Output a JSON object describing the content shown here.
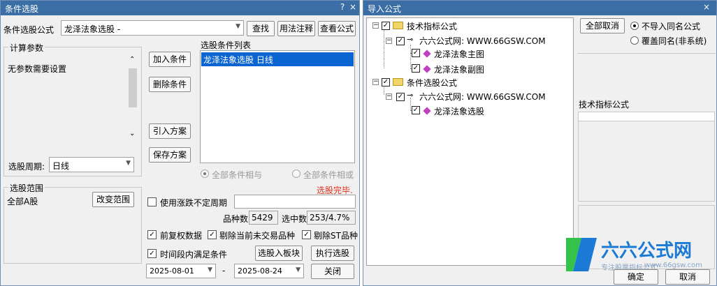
{
  "left": {
    "title": "条件选股",
    "title_buttons": [
      "?",
      "×"
    ],
    "formula_label": "条件选股公式",
    "formula_value": "龙泽法象选股  -",
    "btn_find": "查找",
    "btn_usage": "用法注释",
    "btn_view": "查看公式",
    "calc_group": "计算参数",
    "no_params": "无参数需要设置",
    "period_label": "选股周期:",
    "period_value": "日线",
    "list_title": "选股条件列表",
    "list_items": [
      "龙泽法象选股  日线"
    ],
    "btn_add": "加入条件",
    "btn_delete": "删除条件",
    "btn_import": "引入方案",
    "btn_save": "保存方案",
    "radio_and": "全部条件相与",
    "radio_or": "全部条件相或",
    "status": "选股完毕.",
    "range_group": "选股范围",
    "range_value": "全部A股",
    "btn_range": "改变范围",
    "uncertain_period": "使用涨跌不定周期",
    "count_label": "品种数",
    "count_value": "5429",
    "selected_label": "选中数",
    "selected_value": "253/4.7%",
    "opt_adjust": "前复权数据",
    "opt_remove_untraded": "剔除当前未交易品种",
    "opt_remove_st": "剔除ST品种",
    "opt_time": "时间段内满足条件",
    "btn_to_block": "选股入板块",
    "btn_execute": "执行选股",
    "date_from": "2025-08-01",
    "date_sep": "-",
    "date_to": "2025-08-24",
    "btn_close": "关闭"
  },
  "right": {
    "title": "导入公式",
    "title_buttons": [
      "×"
    ],
    "tree": {
      "node1": "技术指标公式",
      "node1_sub": "六六公式网: WWW.66GSW.COM",
      "node1_leaf1": "龙泽法象主图",
      "node1_leaf2": "龙泽法象副图",
      "node2": "条件选股公式",
      "node2_sub": "六六公式网: WWW.66GSW.COM",
      "node2_leaf1": "龙泽法象选股"
    },
    "btn_cancel_all": "全部取消",
    "radio_no_import": "不导入同名公式",
    "radio_overwrite": "覆盖同名(非系统)",
    "section_label": "技术指标公式",
    "btn_ok": "确定",
    "btn_cancel": "取消"
  },
  "watermark": {
    "brand": "六六公式网",
    "url": "www.66gsw.com",
    "slogan": "专注股票指标公式"
  },
  "colors": {
    "titlebar": "#3a6ea5",
    "selection": "#0a64d2",
    "status_red": "#e0301e",
    "brand_blue": "#1a7ad6",
    "brand_green": "#35c24a"
  }
}
